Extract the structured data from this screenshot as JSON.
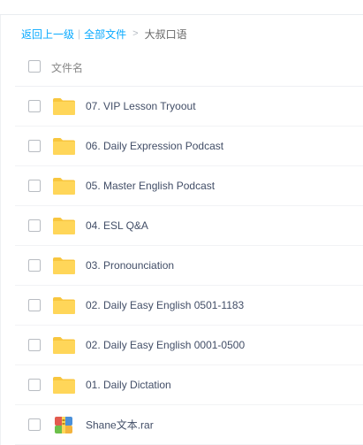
{
  "breadcrumb": {
    "back_label": "返回上一级",
    "separator": "|",
    "all_files_label": "全部文件",
    "arrow": ">",
    "current_label": "大叔口语"
  },
  "list_header": {
    "column_label": "文件名"
  },
  "files": [
    {
      "name": "07. VIP Lesson Tryoout",
      "type": "folder",
      "icon": "folder-icon"
    },
    {
      "name": "06. Daily Expression Podcast",
      "type": "folder",
      "icon": "folder-icon"
    },
    {
      "name": "05. Master English Podcast",
      "type": "folder",
      "icon": "folder-icon"
    },
    {
      "name": "04. ESL Q&A",
      "type": "folder",
      "icon": "folder-icon"
    },
    {
      "name": "03. Pronounciation",
      "type": "folder",
      "icon": "folder-icon"
    },
    {
      "name": "02. Daily Easy English 0501-1183",
      "type": "folder",
      "icon": "folder-icon"
    },
    {
      "name": "02. Daily Easy English 0001-0500",
      "type": "folder",
      "icon": "folder-icon"
    },
    {
      "name": "01. Daily Dictation",
      "type": "folder",
      "icon": "folder-icon"
    },
    {
      "name": "Shane文本.rar",
      "type": "archive",
      "icon": "rar-archive-icon"
    }
  ],
  "colors": {
    "link": "#09aaff",
    "folder": "#ffd659",
    "folder_tab": "#f8c63e",
    "text": "#424e67"
  }
}
